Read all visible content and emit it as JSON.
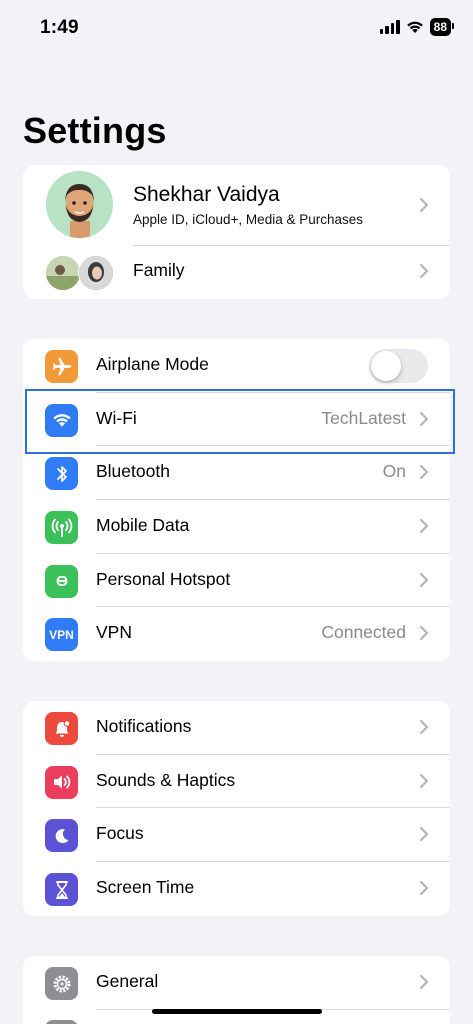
{
  "status": {
    "time": "1:49",
    "battery": "88"
  },
  "page_title": "Settings",
  "profile": {
    "name": "Shekhar Vaidya",
    "subtitle": "Apple ID, iCloud+, Media & Purchases",
    "family_label": "Family"
  },
  "connectivity": [
    {
      "label": "Airplane Mode",
      "icon": "airplane-icon",
      "color": "#f29a38",
      "toggle": false
    },
    {
      "label": "Wi-Fi",
      "icon": "wifi-icon",
      "color": "#2f7cf6",
      "value": "TechLatest"
    },
    {
      "label": "Bluetooth",
      "icon": "bluetooth-icon",
      "color": "#2f7cf6",
      "value": "On"
    },
    {
      "label": "Mobile Data",
      "icon": "antenna-icon",
      "color": "#3cc15a",
      "value": ""
    },
    {
      "label": "Personal Hotspot",
      "icon": "hotspot-icon",
      "color": "#3cc15a",
      "value": ""
    },
    {
      "label": "VPN",
      "icon": "vpn-icon",
      "color": "#2f7cf6",
      "value": "Connected",
      "icon_text": "VPN"
    }
  ],
  "notifications_group": [
    {
      "label": "Notifications",
      "icon": "bell-icon",
      "color": "#eb4a3d"
    },
    {
      "label": "Sounds & Haptics",
      "icon": "speaker-icon",
      "color": "#eb3d5e"
    },
    {
      "label": "Focus",
      "icon": "moon-icon",
      "color": "#5b52d6"
    },
    {
      "label": "Screen Time",
      "icon": "hourglass-icon",
      "color": "#5b52d6"
    }
  ],
  "general_group": [
    {
      "label": "General",
      "icon": "gear-icon",
      "color": "#8e8e93"
    }
  ]
}
